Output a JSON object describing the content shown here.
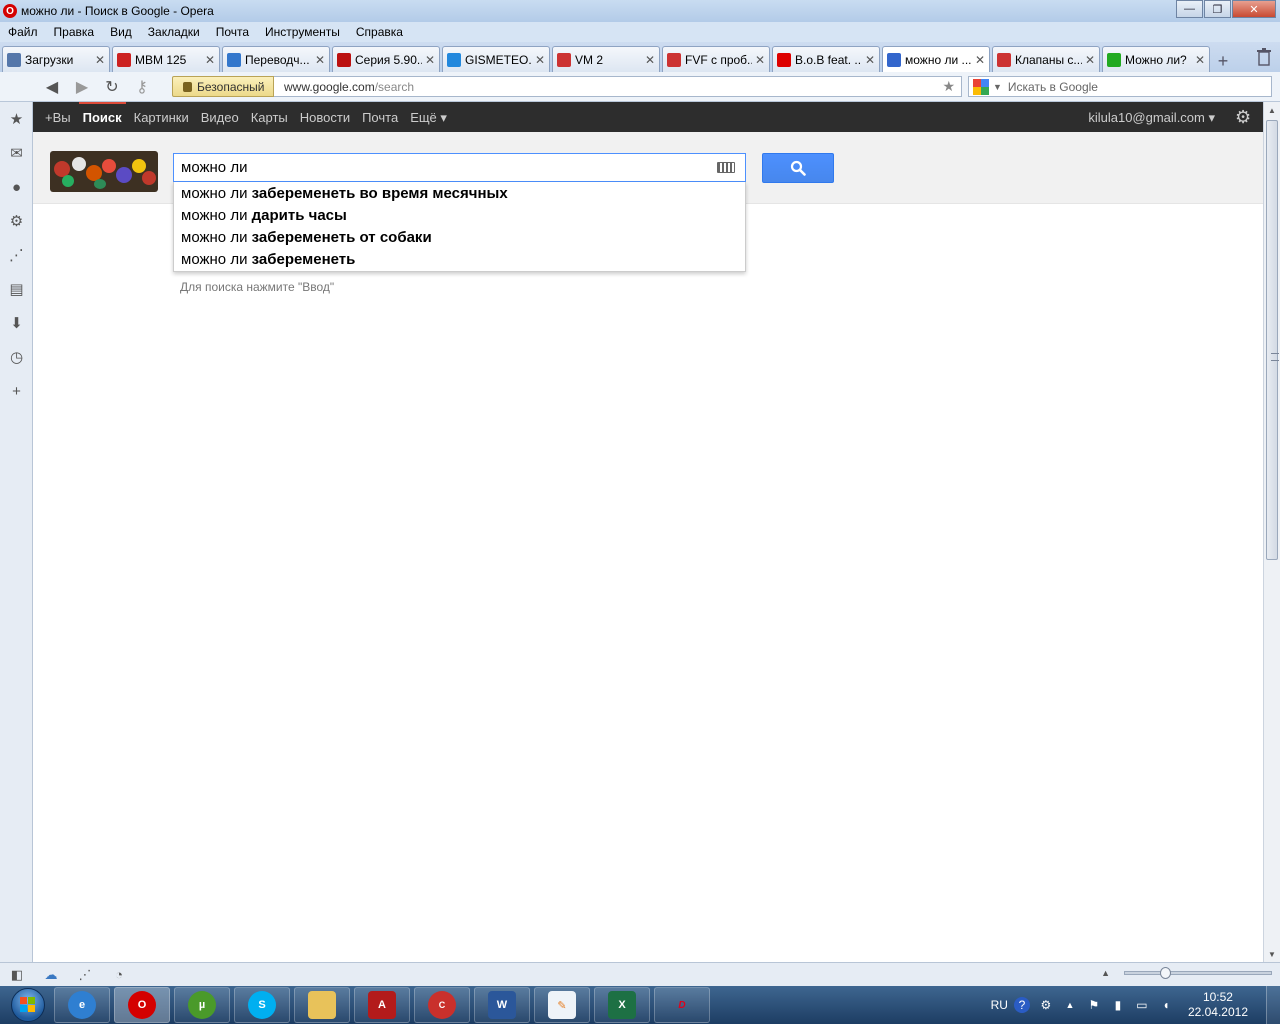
{
  "window": {
    "title": "можно ли - Поиск в Google - Opera",
    "controls": {
      "minimize": "—",
      "maximize": "❐",
      "close": "✕"
    }
  },
  "menu": [
    "Файл",
    "Правка",
    "Вид",
    "Закладки",
    "Почта",
    "Инструменты",
    "Справка"
  ],
  "tabs": [
    {
      "label": "Загрузки",
      "favicon_color": "#5577aa"
    },
    {
      "label": "MBM 125",
      "favicon_color": "#cc2222"
    },
    {
      "label": "Переводч...",
      "favicon_color": "#3377cc"
    },
    {
      "label": "Серия 5.90...",
      "favicon_color": "#bb1111"
    },
    {
      "label": "GISMETEO....",
      "favicon_color": "#2288dd"
    },
    {
      "label": "VM 2",
      "favicon_color": "#cc3333"
    },
    {
      "label": "FVF с проб...",
      "favicon_color": "#cc3333"
    },
    {
      "label": "B.o.B feat. ...",
      "favicon_color": "#dd0000"
    },
    {
      "label": "можно ли ...",
      "favicon_color": "#3366cc",
      "active": true
    },
    {
      "label": "Клапаны с...",
      "favicon_color": "#cc3333"
    },
    {
      "label": "Можно ли?",
      "favicon_color": "#22aa22"
    }
  ],
  "addressbar": {
    "security_label": "Безопасный",
    "url_host": "www.google.com",
    "url_path": "/search",
    "search_placeholder": "Искать в Google"
  },
  "google_bar": {
    "items": [
      "+Вы",
      "Поиск",
      "Картинки",
      "Видео",
      "Карты",
      "Новости",
      "Почта",
      "Ещё ▾"
    ],
    "active_index": 1,
    "account": "kilula10@gmail.com ▾"
  },
  "search": {
    "query": "можно ли",
    "suggestions": [
      {
        "prefix": "можно ли",
        "completion": "забеременеть во время месячных"
      },
      {
        "prefix": "можно ли",
        "completion": "дарить часы"
      },
      {
        "prefix": "можно ли",
        "completion": "забеременеть от собаки"
      },
      {
        "prefix": "можно ли",
        "completion": "забеременеть"
      }
    ],
    "hint": "Для поиска нажмите \"Ввод\""
  },
  "taskbar": {
    "tray_lang": "RU",
    "time": "10:52",
    "date": "22.04.2012"
  },
  "zoom_level_fraction": 0.27,
  "colors": {
    "google_bar": "#2d2d2d",
    "accent_red": "#dd4b39",
    "search_blue": "#4d90fe"
  }
}
